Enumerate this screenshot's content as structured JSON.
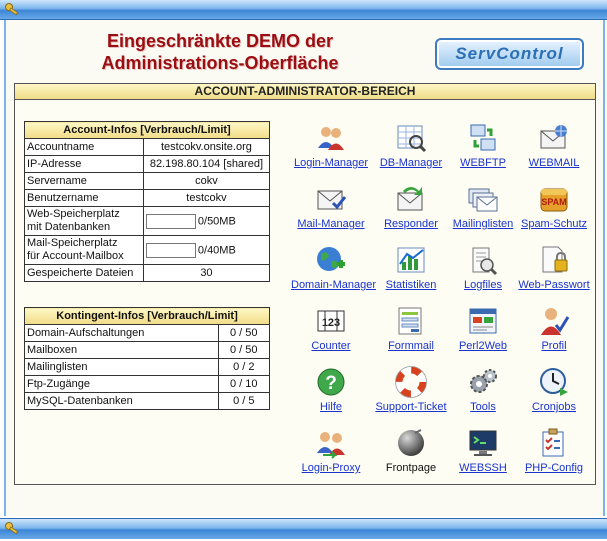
{
  "heading": {
    "line1": "Eingeschränkte DEMO der",
    "line2": "Administrations-Oberfläche"
  },
  "logo_text": "ServControl",
  "section_title": "ACCOUNT-ADMINISTRATOR-BEREICH",
  "account_infos": {
    "title": "Account-Infos [Verbrauch/Limit]",
    "rows": [
      {
        "label": "Accountname",
        "value": "testcokv.onsite.org"
      },
      {
        "label": "IP-Adresse",
        "value": "82.198.80.104 [shared]"
      },
      {
        "label": "Servername",
        "value": "cokv"
      },
      {
        "label": "Benutzername",
        "value": "testcokv"
      },
      {
        "label1": "Web-Speicherplatz",
        "label2": "mit Datenbanken",
        "value": "0/50MB"
      },
      {
        "label1": "Mail-Speicherplatz",
        "label2": "für Account-Mailbox",
        "value": "0/40MB"
      },
      {
        "label": "Gespeicherte Dateien",
        "value": "30"
      }
    ]
  },
  "kontingent_infos": {
    "title": "Kontingent-Infos [Verbrauch/Limit]",
    "rows": [
      {
        "label": "Domain-Aufschaltungen",
        "value": "0 / 50"
      },
      {
        "label": "Mailboxen",
        "value": "0 / 50"
      },
      {
        "label": "Mailinglisten",
        "value": "0 / 2"
      },
      {
        "label": "Ftp-Zugänge",
        "value": "0 / 10"
      },
      {
        "label": "MySQL-Datenbanken",
        "value": "0 / 5"
      }
    ]
  },
  "tools": [
    {
      "label": "Login-Manager",
      "icon": "users-icon"
    },
    {
      "label": "DB-Manager",
      "icon": "database-grid-icon"
    },
    {
      "label": "WEBFTP",
      "icon": "ftp-icon"
    },
    {
      "label": "WEBMAIL",
      "icon": "webmail-icon"
    },
    {
      "label": "Mail-Manager",
      "icon": "mail-manager-icon"
    },
    {
      "label": "Responder",
      "icon": "responder-icon"
    },
    {
      "label": "Mailinglisten",
      "icon": "mailinglist-icon"
    },
    {
      "label": "Spam-Schutz",
      "icon": "spam-icon"
    },
    {
      "label": "Domain-Manager",
      "icon": "globe-icon"
    },
    {
      "label": "Statistiken",
      "icon": "chart-icon"
    },
    {
      "label": "Logfiles",
      "icon": "logfiles-icon"
    },
    {
      "label": "Web-Passwort",
      "icon": "lock-icon"
    },
    {
      "label": "Counter",
      "icon": "counter-icon"
    },
    {
      "label": "Formmail",
      "icon": "form-icon"
    },
    {
      "label": "Perl2Web",
      "icon": "perl-icon"
    },
    {
      "label": "Profil",
      "icon": "profile-icon"
    },
    {
      "label": "Hilfe",
      "icon": "help-icon"
    },
    {
      "label": "Support-Ticket",
      "icon": "lifebuoy-icon"
    },
    {
      "label": "Tools",
      "icon": "gears-icon"
    },
    {
      "label": "Cronjobs",
      "icon": "clock-icon"
    },
    {
      "label": "Login-Proxy",
      "icon": "proxy-icon"
    },
    {
      "label": "Frontpage",
      "icon": "frontpage-icon"
    },
    {
      "label": "WEBSSH",
      "icon": "terminal-icon"
    },
    {
      "label": "PHP-Config",
      "icon": "checklist-icon"
    }
  ]
}
